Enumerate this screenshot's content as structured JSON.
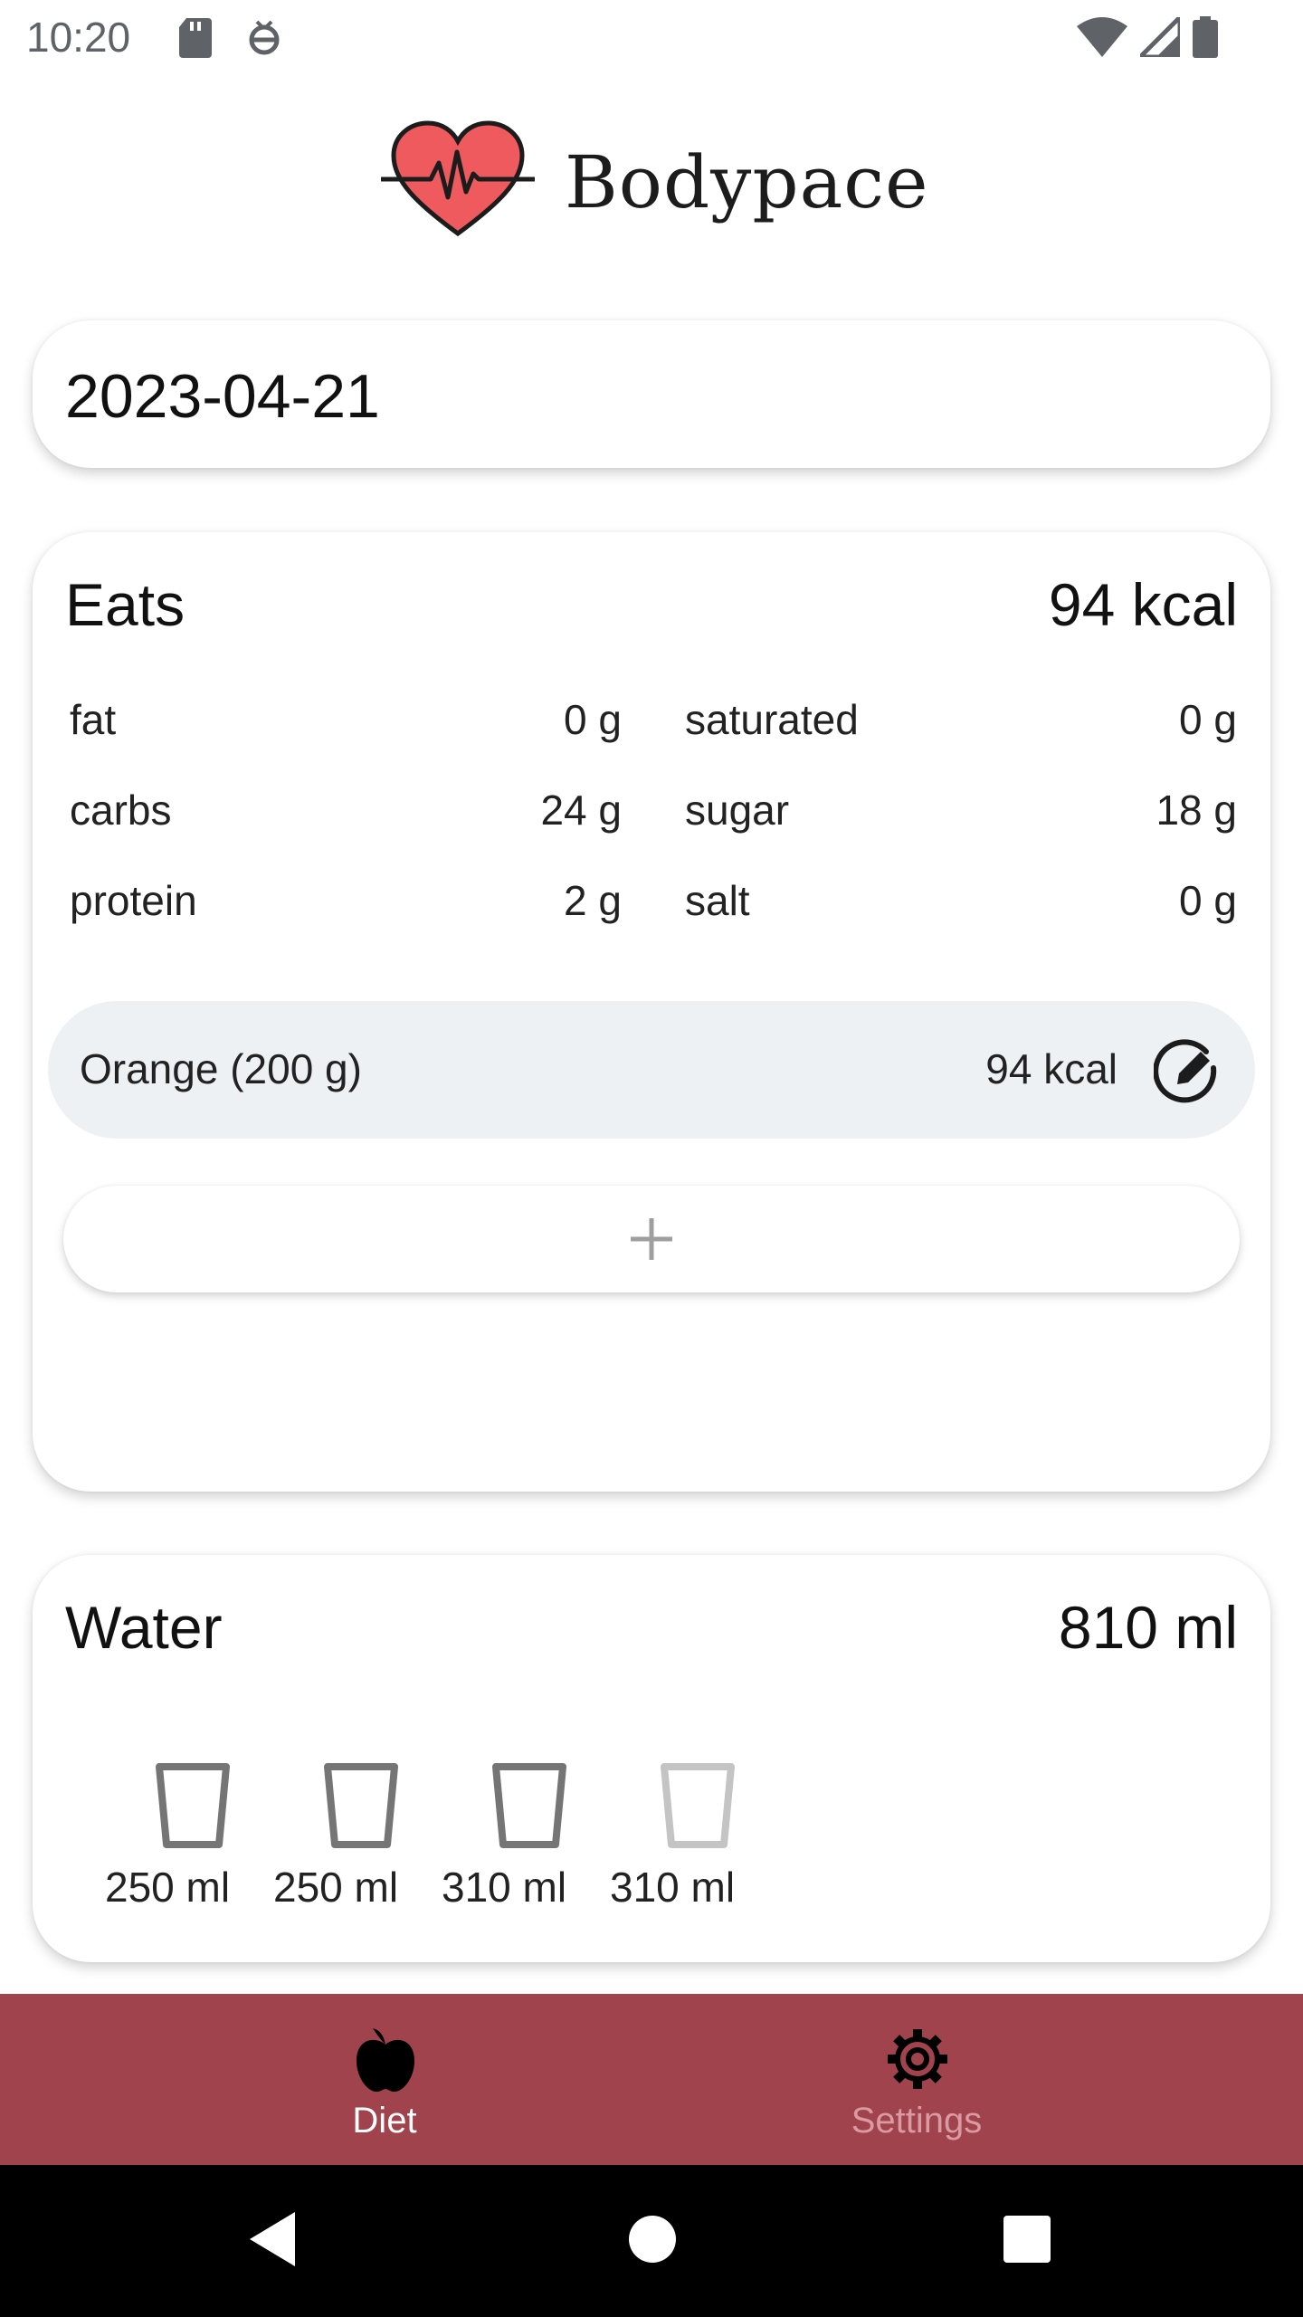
{
  "status_bar": {
    "time": "10:20"
  },
  "app": {
    "title": "Bodypace"
  },
  "date": {
    "value": "2023-04-21"
  },
  "eats": {
    "title": "Eats",
    "total": "94 kcal",
    "nutrients": [
      {
        "label": "fat",
        "value": "0 g"
      },
      {
        "label": "saturated",
        "value": "0 g"
      },
      {
        "label": "carbs",
        "value": "24 g"
      },
      {
        "label": "sugar",
        "value": "18 g"
      },
      {
        "label": "protein",
        "value": "2 g"
      },
      {
        "label": "salt",
        "value": "0 g"
      }
    ],
    "foods": [
      {
        "name": "Orange (200 g)",
        "kcal": "94 kcal"
      }
    ]
  },
  "water": {
    "title": "Water",
    "total": "810 ml",
    "glasses": [
      {
        "label": "250 ml",
        "filled": true
      },
      {
        "label": "250 ml",
        "filled": true
      },
      {
        "label": "310 ml",
        "filled": true
      },
      {
        "label": "310 ml",
        "filled": false
      }
    ]
  },
  "nav": {
    "items": [
      {
        "label": "Diet",
        "icon": "apple-icon",
        "active": true
      },
      {
        "label": "Settings",
        "icon": "gear-icon",
        "active": false
      }
    ]
  },
  "colors": {
    "nav_background": "#a0434d",
    "nav_active": "#ffffff",
    "nav_inactive": "#d99aa1",
    "food_row_background": "#edf1f4",
    "logo_heart": "#ef5a5f"
  }
}
